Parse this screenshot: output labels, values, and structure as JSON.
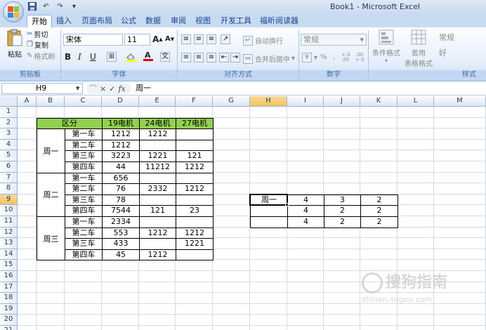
{
  "window": {
    "title": "Book1 - Microsoft Excel"
  },
  "quick_access": {
    "save_icon": "save-icon",
    "undo_icon": "undo-icon",
    "redo_icon": "redo-icon",
    "customize_icon": "customize-qat-icon"
  },
  "tabs": [
    {
      "label": "开始",
      "active": true
    },
    {
      "label": "插入"
    },
    {
      "label": "页面布局"
    },
    {
      "label": "公式"
    },
    {
      "label": "数据"
    },
    {
      "label": "审阅"
    },
    {
      "label": "视图"
    },
    {
      "label": "开发工具"
    },
    {
      "label": "福昕阅读器"
    }
  ],
  "ribbon": {
    "clipboard": {
      "paste": "粘贴",
      "cut": "剪切",
      "copy": "复制",
      "format_painter": "格式刷",
      "label": "剪贴板"
    },
    "font": {
      "name": "宋体",
      "size": "11",
      "bold": "B",
      "italic": "I",
      "underline": "U",
      "label": "字体",
      "grow": "A",
      "shrink": "A"
    },
    "alignment": {
      "wrap": "自动换行",
      "merge": "合并后居中",
      "label": "对齐方式"
    },
    "number": {
      "format": "常规",
      "percent": "%",
      "comma": ",",
      "inc_decimal": "+.0 .00",
      "dec_decimal": ".00 +.0",
      "label": "数字"
    },
    "styles": {
      "conditional": "条件格式",
      "table1": "套用",
      "table2": "表格格式",
      "label": "样式",
      "style_normal": "常规",
      "style_good": "好"
    }
  },
  "formula_bar": {
    "name_box": "H9",
    "formula": "周一",
    "cancel": "×",
    "enter": "✓",
    "fx": "fx"
  },
  "columns": [
    "A",
    "B",
    "C",
    "D",
    "E",
    "F",
    "G",
    "H",
    "I",
    "J",
    "K",
    "L",
    "M"
  ],
  "rows": [
    "1",
    "2",
    "3",
    "4",
    "5",
    "6",
    "7",
    "8",
    "9",
    "10",
    "11",
    "12",
    "13",
    "14",
    "15",
    "16",
    "17",
    "18",
    "19",
    "20",
    "21"
  ],
  "selected": {
    "col": "H",
    "row": "9"
  },
  "table": {
    "header": [
      "区分",
      "19电机",
      "24电机",
      "27电机"
    ],
    "groups": [
      {
        "name": "周一",
        "rows": [
          {
            "car": "第一车",
            "d": "1212",
            "e": "1212",
            "f": ""
          },
          {
            "car": "第二车",
            "d": "1212",
            "e": "",
            "f": ""
          },
          {
            "car": "第三车",
            "d": "3223",
            "e": "1221",
            "f": "121"
          },
          {
            "car": "第四车",
            "d": "44",
            "e": "11212",
            "f": "1212"
          }
        ]
      },
      {
        "name": "周二",
        "rows": [
          {
            "car": "第一车",
            "d": "656",
            "e": "",
            "f": ""
          },
          {
            "car": "第二车",
            "d": "76",
            "e": "2332",
            "f": "1212"
          },
          {
            "car": "第三车",
            "d": "78",
            "e": "",
            "f": ""
          },
          {
            "car": "第四车",
            "d": "7544",
            "e": "121",
            "f": "23"
          }
        ]
      },
      {
        "name": "周三",
        "rows": [
          {
            "car": "第一车",
            "d": "2334",
            "e": "",
            "f": ""
          },
          {
            "car": "第二车",
            "d": "553",
            "e": "1212",
            "f": "1212"
          },
          {
            "car": "第三车",
            "d": "433",
            "e": "",
            "f": "1221"
          },
          {
            "car": "第四车",
            "d": "45",
            "e": "1212",
            "f": ""
          }
        ]
      }
    ]
  },
  "side_table": [
    {
      "h": "周一",
      "i": "4",
      "j": "3",
      "k": "2"
    },
    {
      "h": "",
      "i": "4",
      "j": "2",
      "k": "2"
    },
    {
      "h": "",
      "i": "4",
      "j": "2",
      "k": "2"
    }
  ],
  "watermark": {
    "main": "搜狗指南",
    "sub": "zhinan.sogou.com"
  }
}
